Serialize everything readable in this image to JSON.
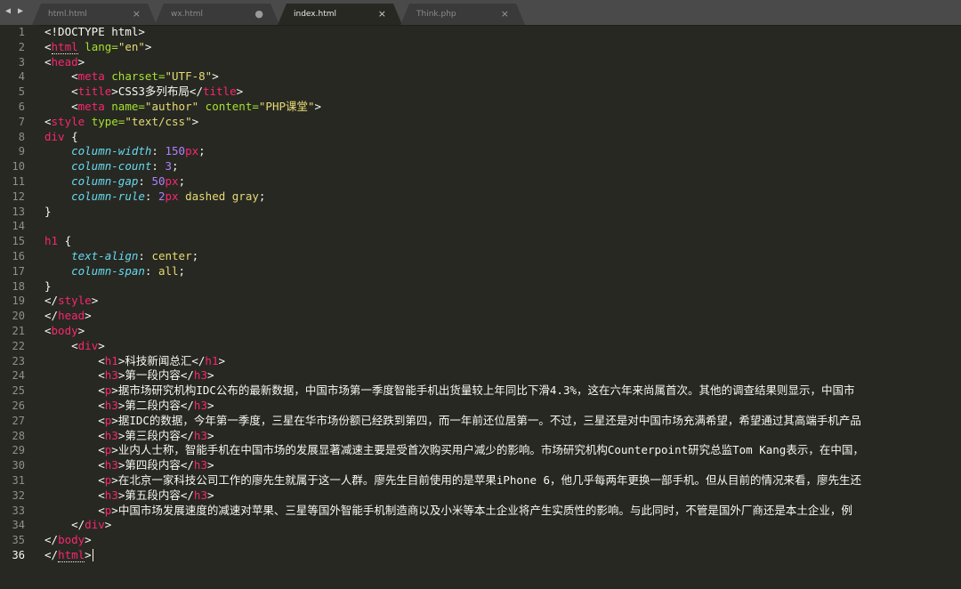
{
  "tabs": [
    {
      "label": "html.html",
      "ctrl": "×",
      "active": false
    },
    {
      "label": "wx.html",
      "ctrl": "●",
      "active": false
    },
    {
      "label": "index.html",
      "ctrl": "×",
      "active": true
    },
    {
      "label": "Think.php",
      "ctrl": "×",
      "active": false
    }
  ],
  "nav": {
    "arrows": "◀ ▶"
  },
  "line_numbers": [
    "1",
    "2",
    "3",
    "4",
    "5",
    "6",
    "7",
    "8",
    "9",
    "10",
    "11",
    "12",
    "13",
    "14",
    "15",
    "16",
    "17",
    "18",
    "19",
    "20",
    "21",
    "22",
    "23",
    "24",
    "25",
    "26",
    "27",
    "28",
    "29",
    "30",
    "31",
    "32",
    "33",
    "34",
    "35",
    "36"
  ],
  "current_line": "36",
  "code": {
    "doctype": "<!DOCTYPE html>",
    "html_open_tag": "html",
    "html_lang_attr": "lang=",
    "html_lang_val": "\"en\"",
    "head_tag": "head",
    "meta_tag": "meta",
    "charset_attr": "charset=",
    "charset_val": "\"UTF-8\"",
    "title_tag": "title",
    "title_text": "CSS3多列布局",
    "name_attr": "name=",
    "name_val": "\"author\"",
    "content_attr": "content=",
    "content_val": "\"PHP课堂\"",
    "style_tag": "style",
    "type_attr": "type=",
    "type_val": "\"text/css\"",
    "sel_div": "div",
    "p_column_width": "column-width",
    "v_150": "150",
    "u_px": "px",
    "p_column_count": "column-count",
    "v_3": "3",
    "p_column_gap": "column-gap",
    "v_50": "50",
    "p_column_rule": "column-rule",
    "v_2": "2",
    "v_dashed_gray": "dashed gray",
    "sel_h1": "h1",
    "p_text_align": "text-align",
    "v_center": "center",
    "p_column_span": "column-span",
    "v_all": "all",
    "body_tag": "body",
    "div_tag": "div",
    "h1_tag": "h1",
    "h3_tag": "h3",
    "p_tag": "p",
    "h1_text": "科技新闻总汇",
    "h3_1": "第一段内容",
    "p_1": "据市场研究机构IDC公布的最新数据，中国市场第一季度智能手机出货量较上年同比下滑4.3%，这在六年来尚属首次。其他的调查结果则显示，中国市",
    "h3_2": "第二段内容",
    "p_2": "据IDC的数据，今年第一季度，三星在华市场份额已经跌到第四，而一年前还位居第一。不过，三星还是对中国市场充满希望，希望通过其高端手机产品",
    "h3_3": "第三段内容",
    "p_3": "业内人士称，智能手机在中国市场的发展显著减速主要是受首次购买用户减少的影响。市场研究机构Counterpoint研究总监Tom Kang表示，在中国，",
    "h3_4": "第四段内容",
    "p_4": "在北京一家科技公司工作的廖先生就属于这一人群。廖先生目前使用的是苹果iPhone 6，他几乎每两年更换一部手机。但从目前的情况来看，廖先生还",
    "h3_5": "第五段内容",
    "p_5": "中国市场发展速度的减速对苹果、三星等国外智能手机制造商以及小米等本土企业将产生实质性的影响。与此同时，不管是国外厂商还是本土企业，例"
  }
}
